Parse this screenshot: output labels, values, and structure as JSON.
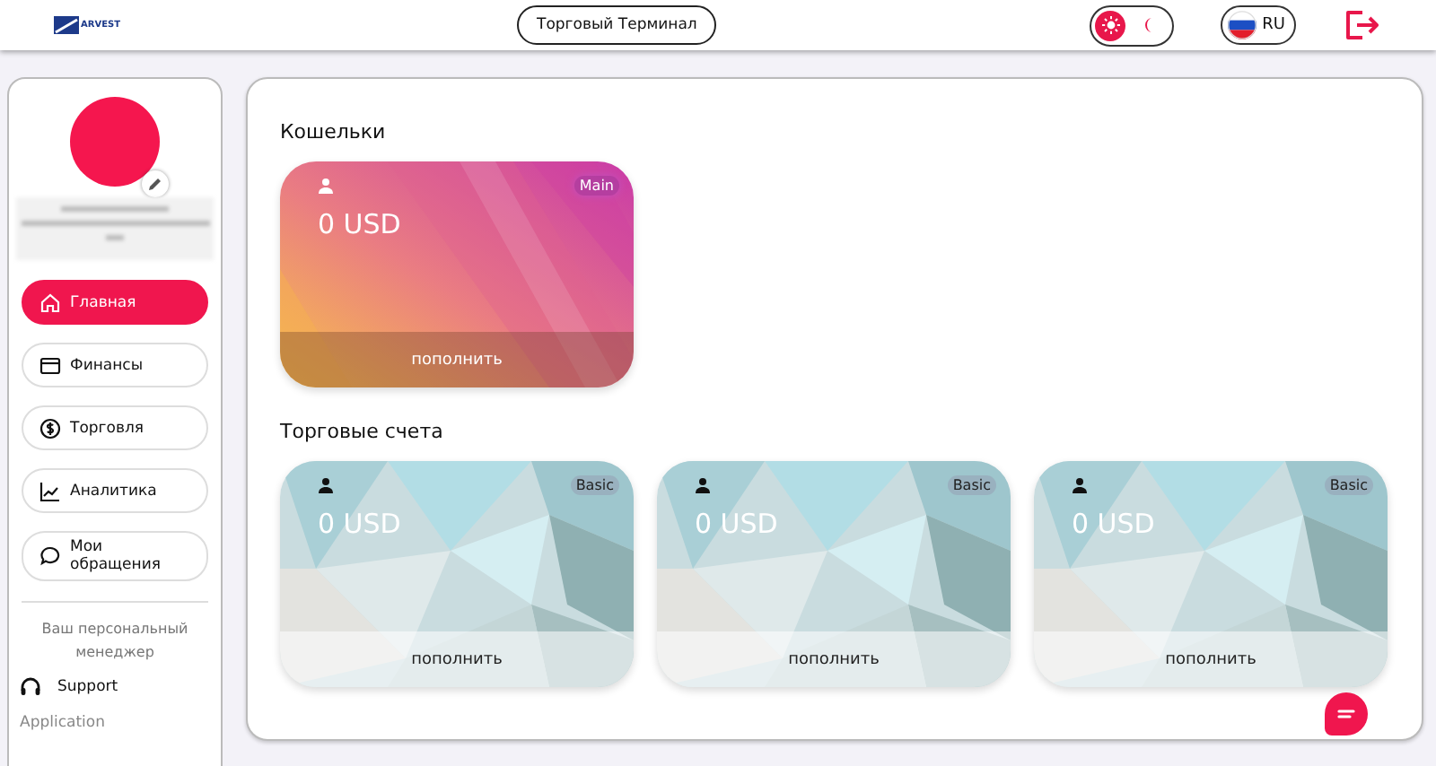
{
  "header": {
    "logo": "ARVEST",
    "terminal_button": "Торговый Терминал",
    "dark_mode": false,
    "language": "RU"
  },
  "sidebar": {
    "items": [
      {
        "label": "Главная",
        "kind": "home",
        "selected": true
      },
      {
        "label": "Финансы",
        "kind": "wallet",
        "selected": false
      },
      {
        "label": "Торговля",
        "kind": "dollar",
        "selected": false
      },
      {
        "label": "Аналитика",
        "kind": "chart",
        "selected": false
      },
      {
        "label": "Мои обращения",
        "kind": "chat",
        "selected": false
      }
    ],
    "manager": "Ваш персональный менеджер",
    "support": "Support",
    "application": "Application"
  },
  "sections": [
    {
      "title": "Кошельки",
      "cards": [
        {
          "kind": "wallet",
          "badge": "Main",
          "amount": "0 USD",
          "action": "пополнить"
        }
      ]
    },
    {
      "title": "Торговые счета",
      "cards": [
        {
          "kind": "trading",
          "badge": "Basic",
          "amount": "0 USD",
          "action": "пополнить"
        },
        {
          "kind": "trading",
          "badge": "Basic",
          "amount": "0 USD",
          "action": "пополнить"
        },
        {
          "kind": "trading",
          "badge": "Basic",
          "amount": "0 USD",
          "action": "пополнить"
        }
      ]
    }
  ]
}
